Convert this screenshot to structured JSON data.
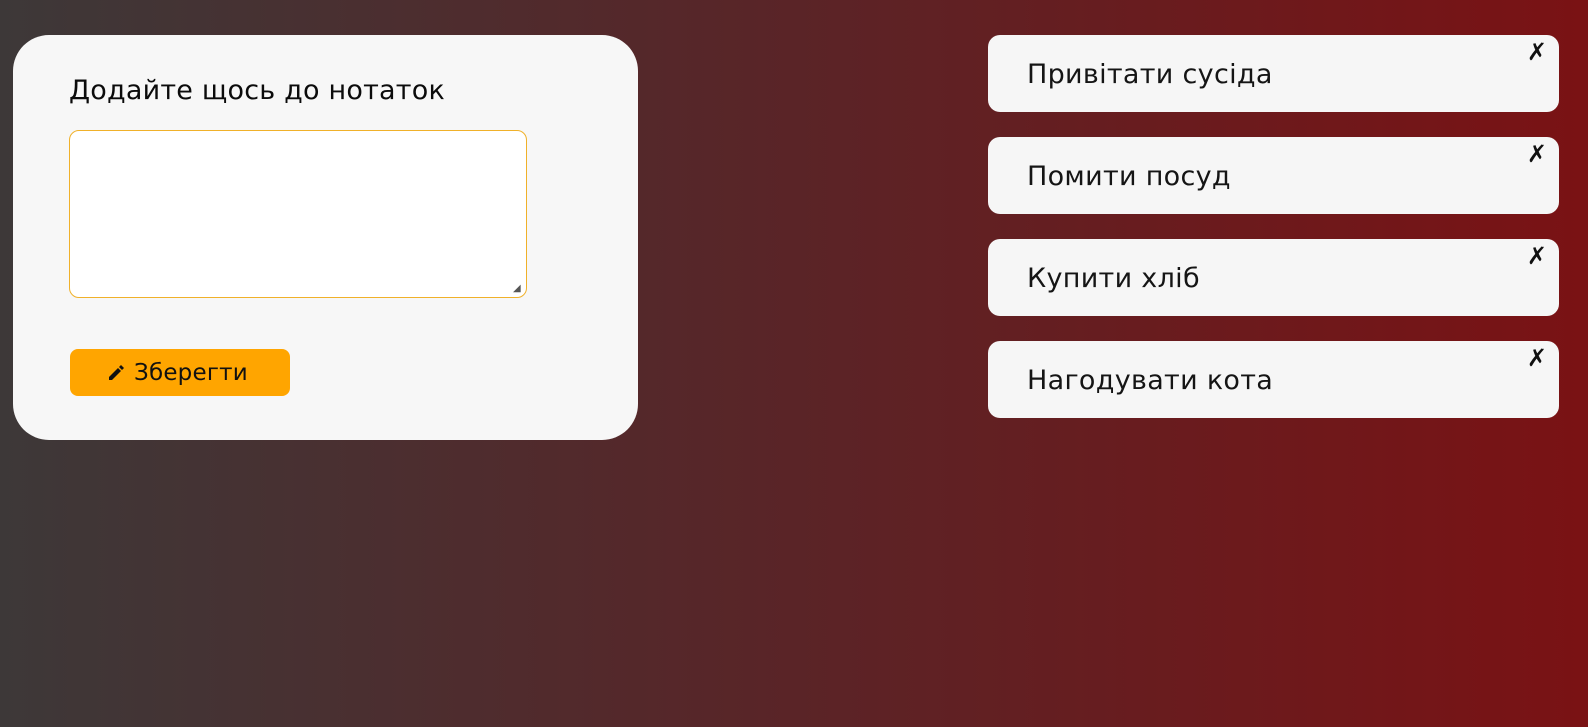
{
  "form": {
    "title": "Додайте щось до нотаток",
    "textarea_value": "",
    "textarea_placeholder": "",
    "save_label": "Зберегти",
    "save_icon": "pencil-icon"
  },
  "notes": [
    {
      "text": "Привітати сусіда",
      "delete_label": "✗"
    },
    {
      "text": "Помити посуд",
      "delete_label": "✗"
    },
    {
      "text": "Купити хліб",
      "delete_label": "✗"
    },
    {
      "text": "Нагодувати кота",
      "delete_label": "✗"
    }
  ],
  "colors": {
    "accent": "#ffa500",
    "card_bg": "#f7f7f7",
    "textarea_border": "#f0b12a",
    "bg_gradient_start": "#3d3838",
    "bg_gradient_end": "#7a1214"
  }
}
